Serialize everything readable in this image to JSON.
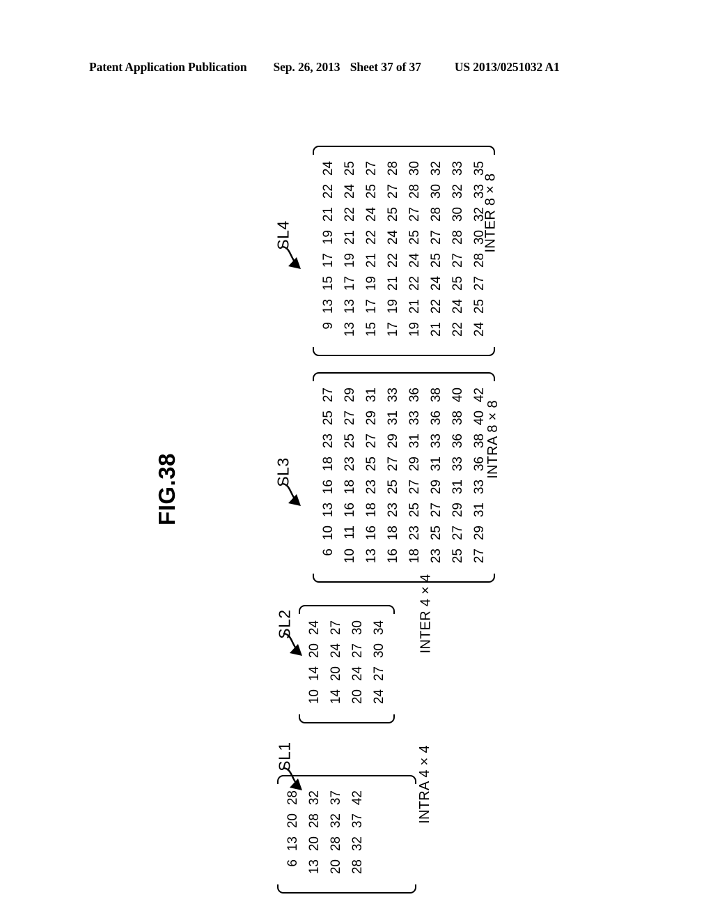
{
  "header": {
    "publication": "Patent Application Publication",
    "date": "Sep. 26, 2013",
    "sheet": "Sheet 37 of 37",
    "patent_number": "US 2013/0251032 A1"
  },
  "figure": {
    "title": "FIG.38"
  },
  "matrices": [
    {
      "id": "sl1",
      "label": "SL1",
      "caption": "INTRA 4 × 4",
      "size": 4,
      "values": [
        [
          6,
          13,
          20,
          28
        ],
        [
          13,
          20,
          28,
          32
        ],
        [
          20,
          28,
          32,
          37
        ],
        [
          28,
          32,
          37,
          42
        ]
      ]
    },
    {
      "id": "sl2",
      "label": "SL2",
      "caption": "INTER 4 × 4",
      "size": 4,
      "values": [
        [
          10,
          14,
          20,
          24
        ],
        [
          14,
          20,
          24,
          27
        ],
        [
          20,
          24,
          27,
          30
        ],
        [
          24,
          27,
          30,
          34
        ]
      ]
    },
    {
      "id": "sl3",
      "label": "SL3",
      "caption": "INTRA 8 × 8",
      "size": 8,
      "values": [
        [
          6,
          10,
          13,
          16,
          18,
          23,
          25,
          27
        ],
        [
          10,
          11,
          16,
          18,
          23,
          25,
          27,
          29
        ],
        [
          13,
          16,
          18,
          23,
          25,
          27,
          29,
          31
        ],
        [
          16,
          18,
          23,
          25,
          27,
          29,
          31,
          33
        ],
        [
          18,
          23,
          25,
          27,
          29,
          31,
          33,
          36
        ],
        [
          23,
          25,
          27,
          29,
          31,
          33,
          36,
          38
        ],
        [
          25,
          27,
          29,
          31,
          33,
          36,
          38,
          40
        ],
        [
          27,
          29,
          31,
          33,
          36,
          38,
          40,
          42
        ]
      ]
    },
    {
      "id": "sl4",
      "label": "SL4",
      "caption": "INTER 8 × 8",
      "size": 8,
      "values": [
        [
          9,
          13,
          15,
          17,
          19,
          21,
          22,
          24
        ],
        [
          13,
          13,
          17,
          19,
          21,
          22,
          24,
          25
        ],
        [
          15,
          17,
          19,
          21,
          22,
          24,
          25,
          27
        ],
        [
          17,
          19,
          21,
          22,
          24,
          25,
          27,
          28
        ],
        [
          19,
          21,
          22,
          24,
          25,
          27,
          28,
          30
        ],
        [
          21,
          22,
          24,
          25,
          27,
          28,
          30,
          32
        ],
        [
          22,
          24,
          25,
          27,
          28,
          30,
          32,
          33
        ],
        [
          24,
          25,
          27,
          28,
          30,
          32,
          33,
          35
        ]
      ]
    }
  ]
}
